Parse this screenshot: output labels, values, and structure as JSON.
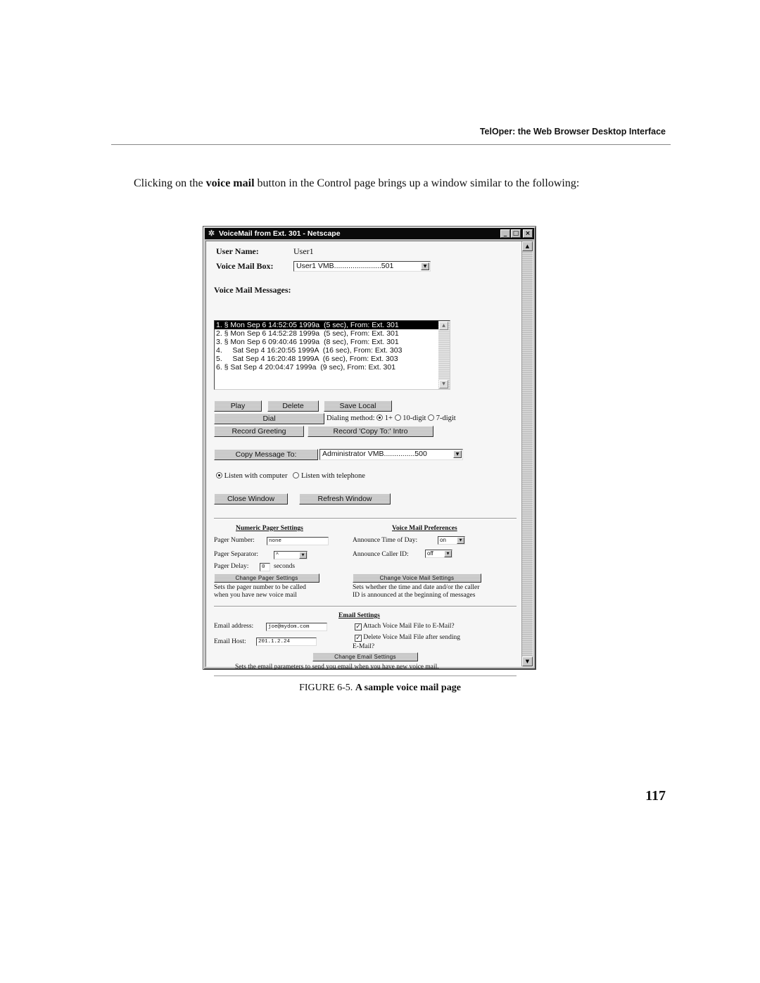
{
  "running_header": "TelOper: the Web Browser Desktop Interface",
  "intro": {
    "before": "Clicking on the ",
    "bold": "voice mail",
    "after": " button in the Control page brings up a window similar to the following:"
  },
  "window": {
    "title": "VoiceMail from Ext. 301 - Netscape",
    "icon": "netscape-icon",
    "controls": {
      "minimize": "_",
      "maximize": "□",
      "close": "×"
    },
    "user_name_label": "User Name:",
    "user_name_value": "User1",
    "mailbox_label": "Voice Mail Box:",
    "mailbox_selected": "User1 VMB.......................501",
    "messages_label": "Voice Mail Messages:",
    "messages": [
      "1. § Mon Sep 6 14:52:05 1999a  (5 sec), From: Ext. 301",
      "2. § Mon Sep 6 14:52:28 1999a  (5 sec), From: Ext. 301",
      "3. § Mon Sep 6 09:40:46 1999a  (8 sec), From: Ext. 301",
      "4.     Sat Sep 4 16:20:55 1999A  (16 sec), From: Ext. 303",
      "5.     Sat Sep 4 16:20:48 1999A  (6 sec), From: Ext. 303",
      "6. § Sat Sep 4 20:04:47 1999a  (9 sec), From: Ext. 301"
    ],
    "selected_message_index": 0,
    "buttons": {
      "play": "Play",
      "delete": "Delete",
      "save_local": "Save Local",
      "dial": "Dial",
      "record_greeting": "Record Greeting",
      "record_copy_intro": "Record 'Copy To:' Intro",
      "copy_message_to": "Copy Message To:",
      "close_window": "Close Window",
      "refresh_window": "Refresh Window"
    },
    "dialing": {
      "label": "Dialing method:",
      "options": [
        "1+",
        "10-digit",
        "7-digit"
      ],
      "selected": "1+"
    },
    "copy_to_selected": "Administrator VMB...............500",
    "listen": {
      "options": [
        "Listen with computer",
        "Listen with telephone"
      ],
      "selected": "Listen with computer"
    },
    "pager": {
      "title": "Numeric Pager Settings",
      "number_label": "Pager Number:",
      "number_value": "none",
      "separator_label": "Pager Separator:",
      "separator_value": "^",
      "delay_label": "Pager Delay:",
      "delay_value": "0",
      "delay_unit": "seconds",
      "button": "Change Pager Settings",
      "desc_line1": "Sets the pager number to be called",
      "desc_line2": "when you have new voice mail"
    },
    "preferences": {
      "title": "Voice Mail Preferences",
      "time_label": "Announce Time of Day:",
      "time_value": "on",
      "caller_label": "Announce Caller ID:",
      "caller_value": "off",
      "button": "Change Voice Mail Settings",
      "desc_line1": "Sets whether the time and date and/or the caller",
      "desc_line2": "ID is announced at the beginning of messages"
    },
    "email": {
      "title": "Email Settings",
      "address_label": "Email address:",
      "address_value": "joe@mydom.com",
      "host_label": "Email Host:",
      "host_value": "201.1.2.24",
      "attach_label": "Attach Voice Mail File to E-Mail?",
      "attach_checked": true,
      "delete_label": "Delete Voice Mail File after sending",
      "delete_label_cont": "E-Mail?",
      "delete_checked": true,
      "button": "Change Email Settings",
      "desc": "Sets the email parameters to send you email when you have new voice mail."
    }
  },
  "caption": {
    "label": "FIGURE 6-5.",
    "text": "A sample voice mail page"
  },
  "page_number": "117"
}
